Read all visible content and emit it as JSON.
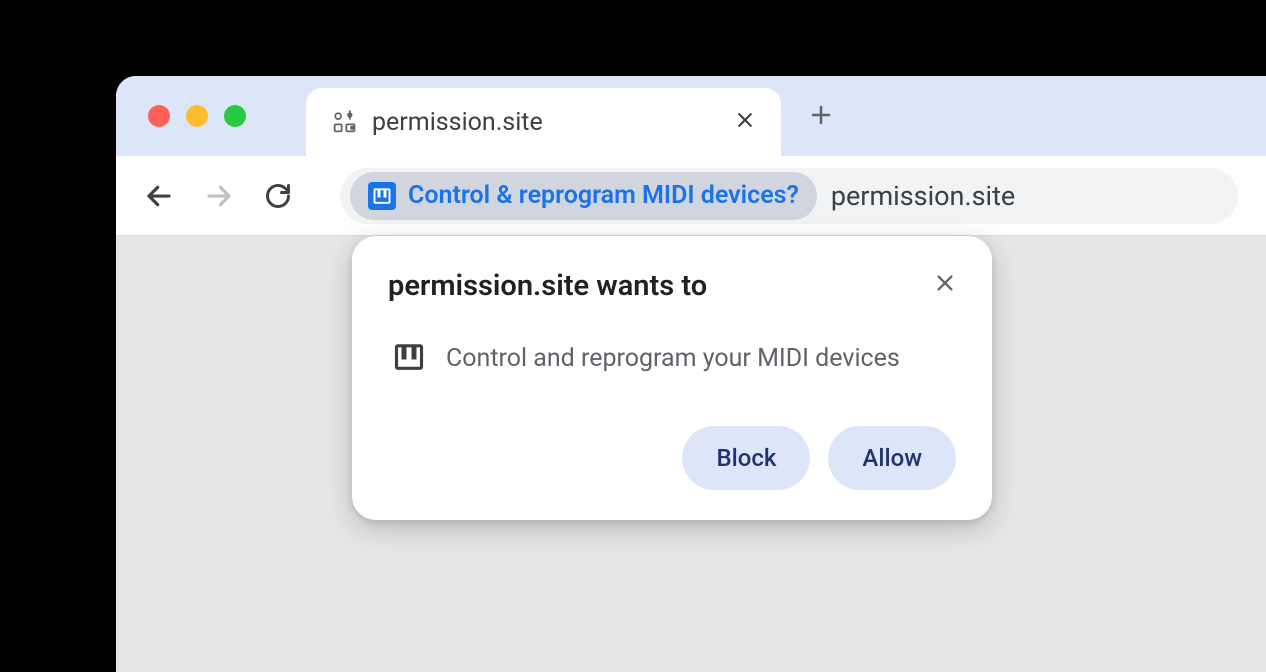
{
  "tab": {
    "title": "permission.site"
  },
  "omnibox": {
    "chip_text": "Control & reprogram MIDI devices?",
    "url": "permission.site"
  },
  "popup": {
    "title": "permission.site wants to",
    "body_text": "Control and reprogram your MIDI devices",
    "block_label": "Block",
    "allow_label": "Allow"
  }
}
